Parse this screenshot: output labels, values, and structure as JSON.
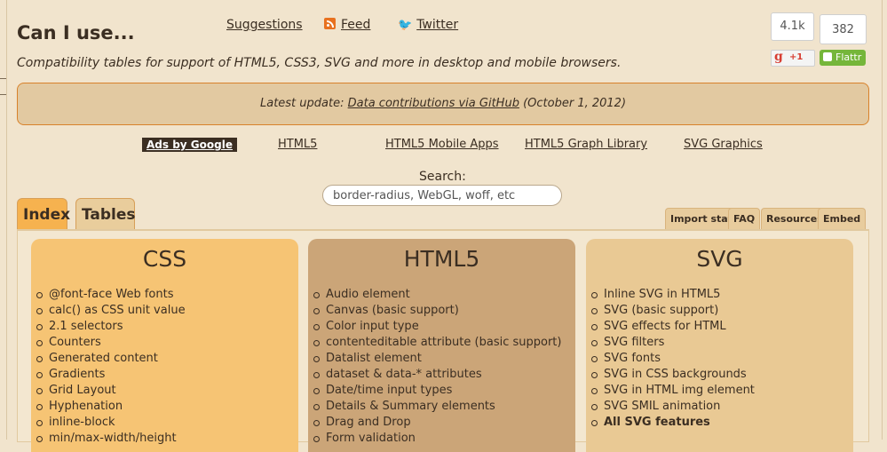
{
  "site": {
    "title": "Can I use...",
    "tagline": "Compatibility tables for support of HTML5, CSS3, SVG and more in desktop and mobile browsers."
  },
  "toplinks": {
    "suggestions": "Suggestions",
    "feed": "Feed",
    "twitter": "Twitter"
  },
  "social": {
    "gplus_count": "4.1k",
    "gplus_label": "+1",
    "flattr_count": "382",
    "flattr_label": "Flattr"
  },
  "update": {
    "prefix": "Latest update:",
    "link": "Data contributions via GitHub",
    "date": "(October 1, 2012)"
  },
  "ads": {
    "label": "Ads by Google",
    "links": [
      "HTML5",
      "HTML5 Mobile Apps",
      "HTML5 Graph Library",
      "SVG Graphics"
    ]
  },
  "search": {
    "label": "Search:",
    "placeholder": "border-radius, WebGL, woff, etc"
  },
  "tabs": [
    "Index",
    "Tables"
  ],
  "minitabs": [
    "Import stats",
    "FAQ",
    "Resources",
    "Embed"
  ],
  "columns": [
    {
      "title": "CSS",
      "color": "#f6c474",
      "items": [
        "@font-face Web fonts",
        "calc() as CSS unit value",
        "2.1 selectors",
        "Counters",
        "Generated content",
        "Gradients",
        "Grid Layout",
        "Hyphenation",
        "inline-block",
        "min/max-width/height"
      ]
    },
    {
      "title": "HTML5",
      "color": "#cba578",
      "items": [
        "Audio element",
        "Canvas (basic support)",
        "Color input type",
        "contenteditable attribute (basic support)",
        "Datalist element",
        "dataset & data-* attributes",
        "Date/time input types",
        "Details & Summary elements",
        "Drag and Drop",
        "Form validation"
      ]
    },
    {
      "title": "SVG",
      "color": "#e9c994",
      "items": [
        "Inline SVG in HTML5",
        "SVG (basic support)",
        "SVG effects for HTML",
        "SVG filters",
        "SVG fonts",
        "SVG in CSS backgrounds",
        "SVG in HTML img element",
        "SVG SMIL animation",
        "All SVG features"
      ]
    }
  ]
}
